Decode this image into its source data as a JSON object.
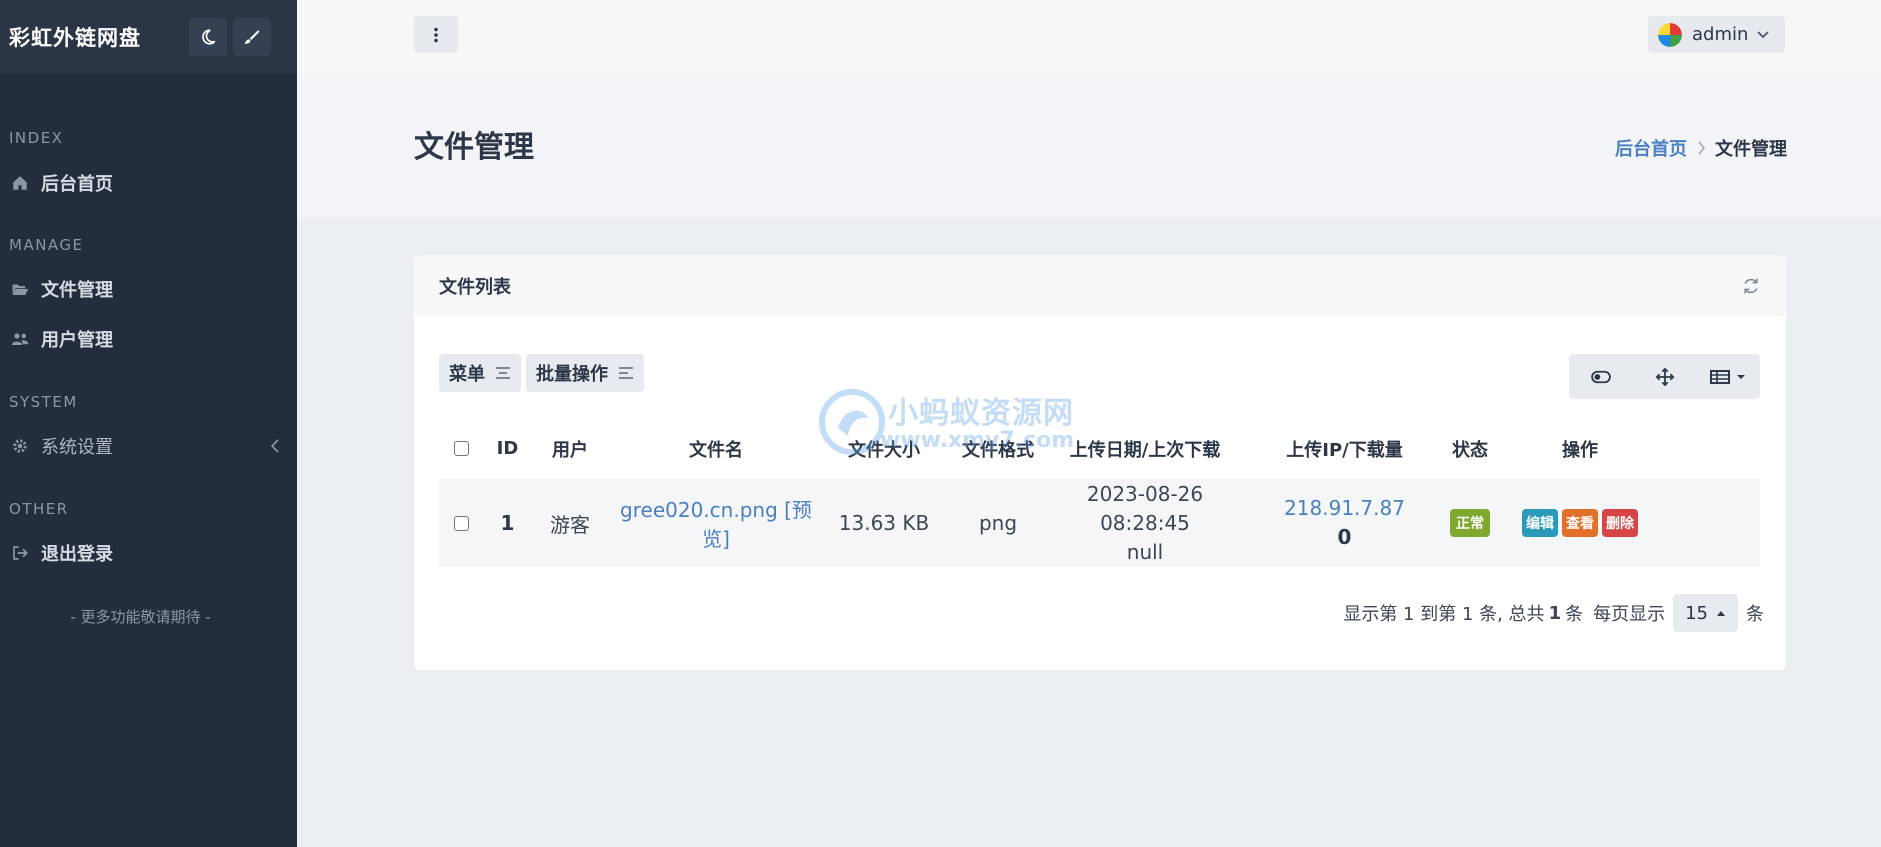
{
  "brand": {
    "title": "彩虹外链网盘"
  },
  "sidebar": {
    "sections": [
      {
        "heading": "INDEX",
        "items": [
          {
            "label": "后台首页",
            "icon": "home-icon"
          }
        ]
      },
      {
        "heading": "MANAGE",
        "items": [
          {
            "label": "文件管理",
            "icon": "folder-open-icon"
          },
          {
            "label": "用户管理",
            "icon": "users-icon"
          }
        ]
      },
      {
        "heading": "SYSTEM",
        "items": [
          {
            "label": "系统设置",
            "icon": "gear-icon"
          }
        ]
      },
      {
        "heading": "OTHER",
        "items": [
          {
            "label": "退出登录",
            "icon": "sign-out-icon"
          }
        ]
      }
    ],
    "footer": "- 更多功能敬请期待 -"
  },
  "topbar": {
    "user_name": "admin"
  },
  "page": {
    "title": "文件管理",
    "breadcrumb": [
      "后台首页",
      "文件管理"
    ]
  },
  "card": {
    "title": "文件列表",
    "toolbar": {
      "menu_label": "菜单",
      "batch_label": "批量操作"
    }
  },
  "table": {
    "headers": {
      "id": "ID",
      "user": "用户",
      "filename": "文件名",
      "size": "文件大小",
      "format": "文件格式",
      "date": "上传日期/上次下载",
      "ip": "上传IP/下载量",
      "status": "状态",
      "ops": "操作"
    },
    "rows": [
      {
        "id": "1",
        "user": "游客",
        "filename": "gree020.cn.png",
        "preview": "[预览]",
        "size": "13.63 KB",
        "format": "png",
        "upload_date": "2023-08-26 08:28:45",
        "last_download": "null",
        "ip": "218.91.7.87",
        "downloads": "0",
        "status": "正常",
        "ops": {
          "edit": "编辑",
          "view": "查看",
          "delete": "删除"
        }
      }
    ]
  },
  "pager": {
    "summary_prefix": "显示第 1 到第 1 条, 总共",
    "total": "1",
    "summary_suffix": "条",
    "per_page_label": "每页显示",
    "page_size": "15",
    "unit": "条"
  },
  "watermark": {
    "text": "小蚂蚁资源网",
    "sub": "www.xmy7.com"
  },
  "colors": {
    "sidebar_bg": "#232d3b",
    "link": "#4a7fc1",
    "status_ok": "#7fa82f",
    "edit": "#2b9ab8",
    "view": "#e1702a",
    "delete": "#d64545"
  }
}
